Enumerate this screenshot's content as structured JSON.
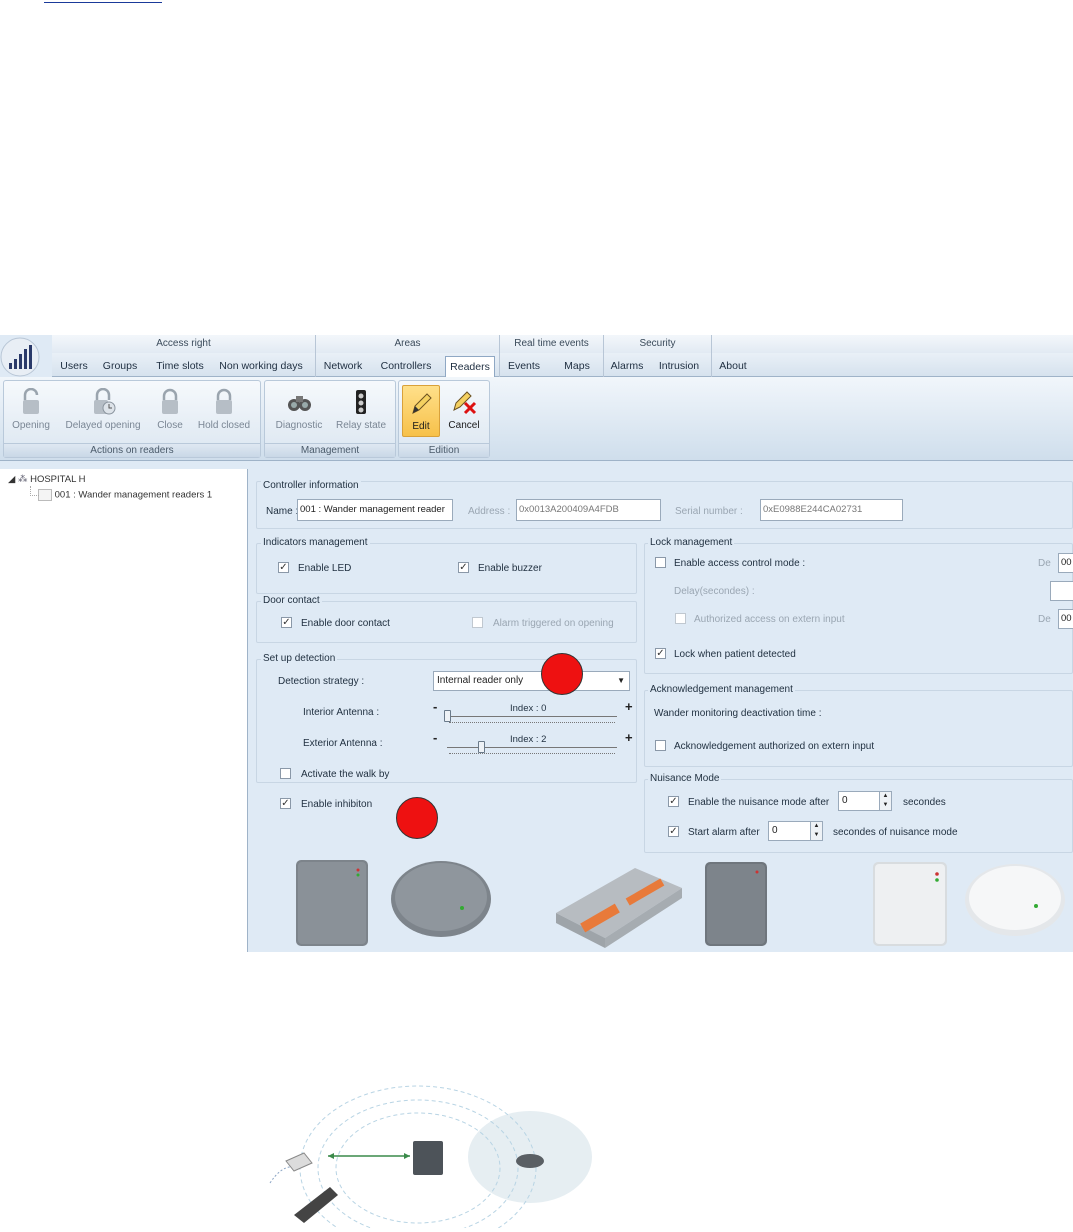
{
  "ribbon": {
    "groups": [
      "Access right",
      "Areas",
      "Real time events",
      "Security"
    ],
    "tabs": [
      "Users",
      "Groups",
      "Time slots",
      "Non working days",
      "Network",
      "Controllers",
      "Readers",
      "Events",
      "Maps",
      "Alarms",
      "Intrusion",
      "About"
    ],
    "active_tab": "Readers"
  },
  "toolbar": {
    "actions_group_label": "Actions on readers",
    "actions": [
      "Opening",
      "Delayed opening",
      "Close",
      "Hold closed"
    ],
    "management_group_label": "Management",
    "management": [
      "Diagnostic",
      "Relay state"
    ],
    "edition_group_label": "Edition",
    "edit_label": "Edit",
    "cancel_label": "Cancel"
  },
  "tree": {
    "root": "HOSPITAL H",
    "child": "001 : Wander management readers 1"
  },
  "controller_info": {
    "title": "Controller information",
    "name_label": "Name :",
    "name_value": "001 : Wander management reader",
    "address_label": "Address :",
    "address_value": "0x0013A200409A4FDB",
    "serial_label": "Serial number :",
    "serial_value": "0xE0988E244CA02731"
  },
  "indicators": {
    "title": "Indicators management",
    "enable_led": "Enable LED",
    "enable_buzzer": "Enable buzzer"
  },
  "door_contact": {
    "title": "Door contact",
    "enable_door_contact": "Enable door contact",
    "alarm_triggered": "Alarm triggered on opening"
  },
  "detection": {
    "title": "Set up detection",
    "strategy_label": "Detection strategy :",
    "strategy_value": "Internal reader only",
    "interior_label": "Interior Antenna :",
    "interior_index": "Index : 0",
    "interior_value": 0,
    "exterior_label": "Exterior Antenna :",
    "exterior_index": "Index : 2",
    "exterior_value": 2,
    "walk_by": "Activate the walk by",
    "inhibiton": "Enable inhibiton",
    "minus": "-",
    "plus": "+"
  },
  "lock": {
    "title": "Lock management",
    "access_control": "Enable access control mode :",
    "de1": "De",
    "de1_value": "00",
    "delay_label": "Delay(secondes) :",
    "authorized_extern": "Authorized access on extern input",
    "de2": "De",
    "de2_value": "00",
    "lock_patient": "Lock when patient detected"
  },
  "ack": {
    "title": "Acknowledgement management",
    "deactivation_time": "Wander monitoring deactivation time :",
    "authorized_extern": "Acknowledgement authorized on extern input"
  },
  "nuisance": {
    "title": "Nuisance Mode",
    "enable_after": "Enable the nuisance mode after",
    "enable_after_value": "0",
    "enable_after_unit": "secondes",
    "start_alarm": "Start alarm after",
    "start_alarm_value": "0",
    "start_alarm_unit": "secondes of nuisance mode"
  },
  "colors": {
    "ribbon_bg": "#dfeaf5",
    "edit_highlight": "#f7c14a",
    "marker_red": "#ee1111"
  }
}
